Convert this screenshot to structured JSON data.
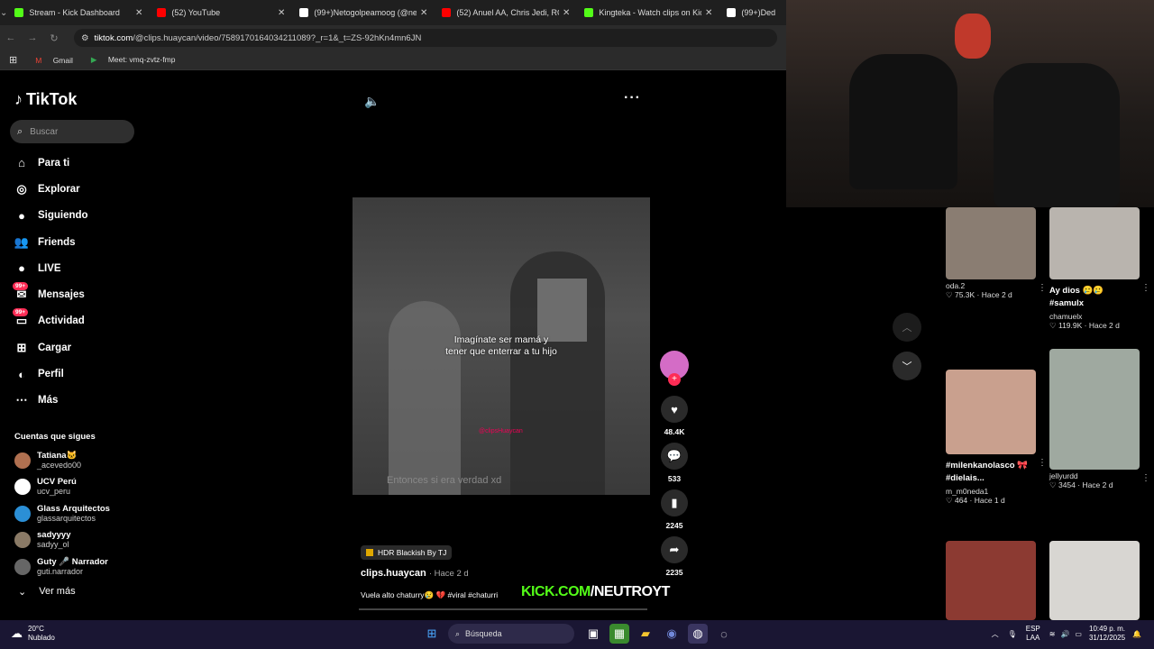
{
  "browser": {
    "tabs": [
      {
        "title": "Stream - Kick Dashboard",
        "color": "#53fc18"
      },
      {
        "title": "(52) YouTube",
        "color": "#ff0000"
      },
      {
        "title": "(99+)Netogolpeamoog (@neto",
        "color": "#ffffff"
      },
      {
        "title": "(52) Anuel AA, Chris Jedi, ROA",
        "color": "#ff0000"
      },
      {
        "title": "Kingteka - Watch clips on Kick",
        "color": "#53fc18"
      },
      {
        "title": "(99+)Ded",
        "color": "#ffffff"
      }
    ],
    "url_host": "tiktok.com",
    "url_path": "/@clips.huaycan/video/7589170164034211089?_r=1&_t=ZS-92hKn4mn6JN",
    "bookmarks": [
      "Gmail",
      "Meet: vmq-zvtz-fmp"
    ]
  },
  "sidebar": {
    "logo": "TikTok",
    "search_placeholder": "Buscar",
    "items": [
      {
        "label": "Para ti",
        "icon": "home-icon",
        "glyph": "⌂"
      },
      {
        "label": "Explorar",
        "icon": "compass-icon",
        "glyph": "◎"
      },
      {
        "label": "Siguiendo",
        "icon": "following-avatar-icon",
        "glyph": "●"
      },
      {
        "label": "Friends",
        "icon": "friends-icon",
        "glyph": "👥"
      },
      {
        "label": "LIVE",
        "icon": "live-icon",
        "glyph": "●"
      },
      {
        "label": "Mensajes",
        "icon": "messages-icon",
        "glyph": "✉",
        "badge": "99+"
      },
      {
        "label": "Actividad",
        "icon": "activity-icon",
        "glyph": "▭",
        "badge": "99+"
      },
      {
        "label": "Cargar",
        "icon": "upload-icon",
        "glyph": "⊞"
      },
      {
        "label": "Perfil",
        "icon": "profile-icon",
        "glyph": "◐"
      },
      {
        "label": "Más",
        "icon": "more-icon",
        "glyph": "⋯"
      }
    ],
    "follows_title": "Cuentas que sigues",
    "follows": [
      {
        "name": "Tatiana🐱",
        "handle": "_acevedo00",
        "color": "#b07050"
      },
      {
        "name": "UCV Perú",
        "handle": "ucv_peru",
        "color": "#ffffff"
      },
      {
        "name": "Glass Arquitectos",
        "handle": "glassarquitectos",
        "color": "#2b8fd6"
      },
      {
        "name": "sadyyyy",
        "handle": "sadyy_ol",
        "color": "#8a7a66"
      },
      {
        "name": "Guty 🎤 Narrador",
        "handle": "guti.narrador",
        "color": "#666666"
      }
    ],
    "see_more": "Ver más"
  },
  "video": {
    "caption_line1": "Imagínate ser mamá y",
    "caption_line2": "tener que enterrar a tu hijo",
    "subtitle": "Entonces si era verdad xd",
    "watermark": "@clipsHuaycan",
    "music": "HDR Blackish By TJ",
    "author": "clips.huaycan",
    "ago": "· Hace 2 d",
    "description": "Vuela alto chaturry😢 💔 #viral #chaturri",
    "overlay_kick": "KICK.COM",
    "overlay_user": "/NEUTROYT"
  },
  "actions": {
    "likes": "48.4K",
    "comments": "533",
    "saves": "2245",
    "shares": "2235"
  },
  "related": [
    {
      "caption": "",
      "name": "oda.2",
      "stats": "♡ 75.3K · Hace 2 d",
      "color": "#8a7d72"
    },
    {
      "caption": "Ay dios 🥲🥲 #samulx",
      "name": "chamuelx",
      "stats": "♡ 119.9K · Hace 2 d",
      "color": "#b9b4ae"
    },
    {
      "caption": "#milenkanolasco 🎀 #dielais...",
      "name": "m_m0neda1",
      "stats": "♡ 464 · Hace 1 d",
      "color": "#c9a08e"
    },
    {
      "caption": "",
      "name": "jellyurdd",
      "stats": "♡ 3454 · Hace 2 d",
      "color": "#9fa9a0"
    },
    {
      "caption": "",
      "name": "",
      "stats": "",
      "color": "#8c3a32"
    },
    {
      "caption": "",
      "name": "",
      "stats": "",
      "color": "#d8d6d2"
    }
  ],
  "taskbar": {
    "temp": "20°C",
    "weather": "Nublado",
    "search": "Búsqueda",
    "lang1": "ESP",
    "lang2": "LAA",
    "time": "10:49 p. m.",
    "date": "31/12/2025"
  }
}
